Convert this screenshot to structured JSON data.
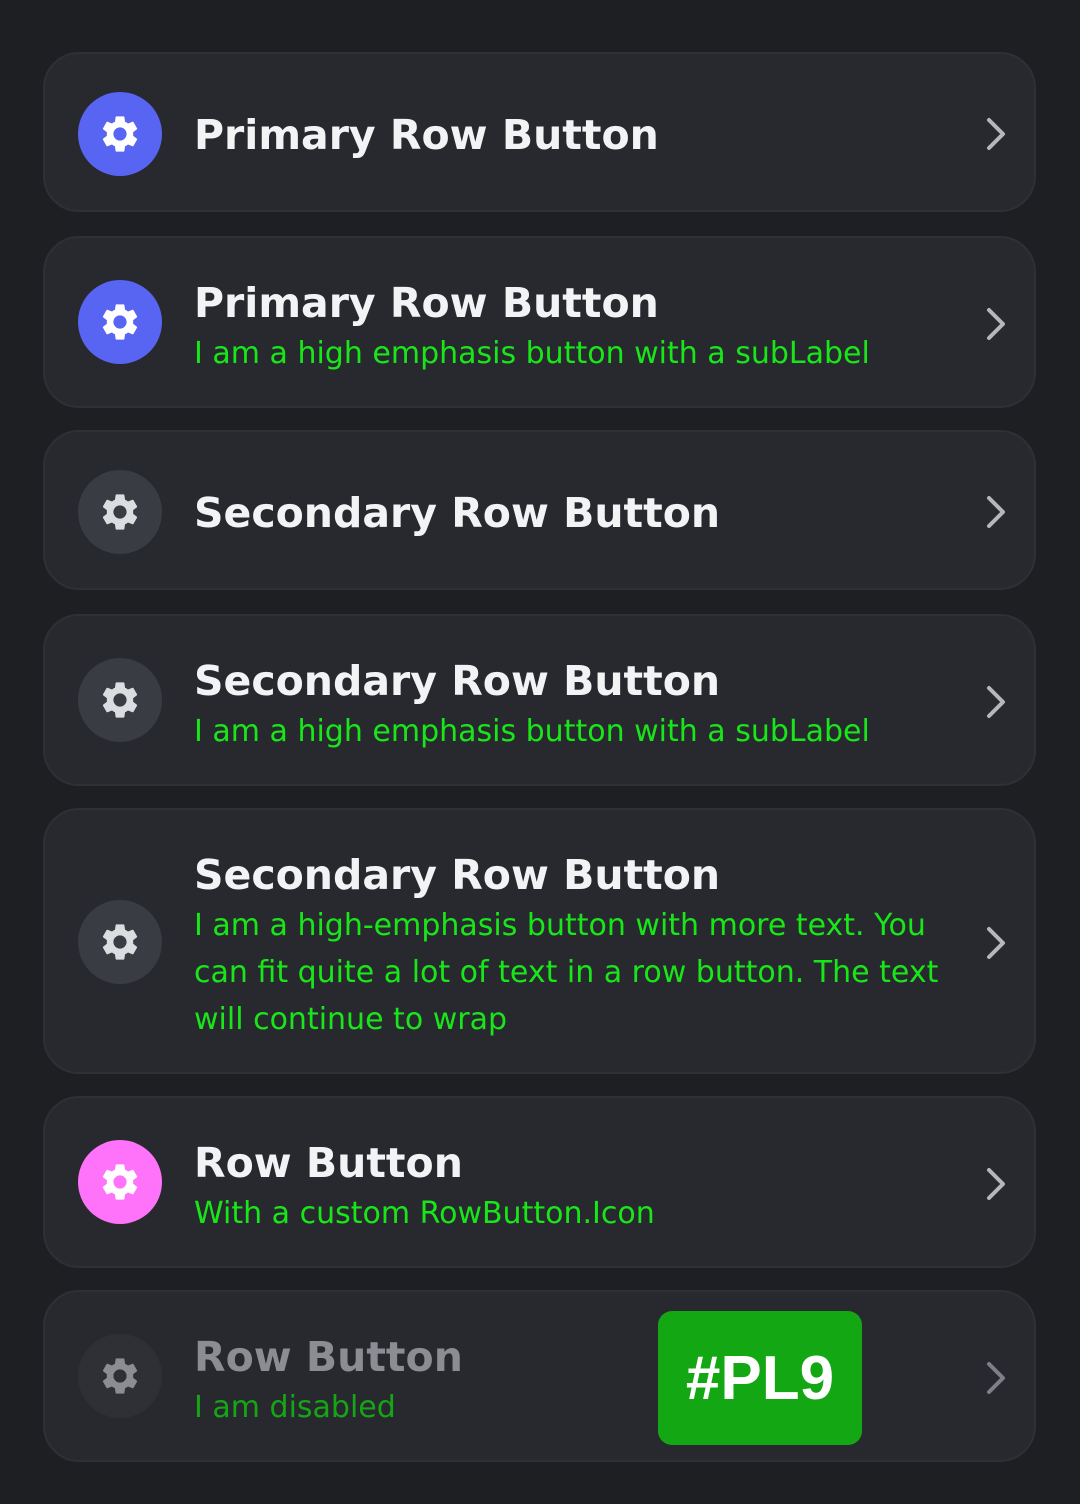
{
  "colors": {
    "primary_icon_bg": "#5865f2",
    "secondary_icon_bg": "#3a3c43",
    "custom_icon_bg": "#ff73fa",
    "sublabel_text": "#19e619",
    "badge_bg": "#13a813"
  },
  "rows": [
    {
      "label": "Primary Row Button",
      "sublabel": "",
      "icon": "gear-icon",
      "variant": "primary"
    },
    {
      "label": "Primary Row Button",
      "sublabel": "I am a high emphasis button with a subLabel",
      "icon": "gear-icon",
      "variant": "primary"
    },
    {
      "label": "Secondary Row Button",
      "sublabel": "",
      "icon": "gear-icon",
      "variant": "secondary"
    },
    {
      "label": "Secondary Row Button",
      "sublabel": "I am a high emphasis button with a subLabel",
      "icon": "gear-icon",
      "variant": "secondary"
    },
    {
      "label": "Secondary Row Button",
      "sublabel": "I am a high-emphasis button with more text. You can fit quite a lot of text in a row button. The text will continue to wrap",
      "icon": "gear-icon",
      "variant": "secondary"
    },
    {
      "label": "Row Button",
      "sublabel": "With a custom RowButton.Icon",
      "icon": "gear-icon",
      "variant": "custom"
    },
    {
      "label": "Row Button",
      "sublabel": "I am disabled",
      "icon": "gear-icon",
      "variant": "disabled"
    }
  ],
  "badge": {
    "text": "#PL9"
  }
}
